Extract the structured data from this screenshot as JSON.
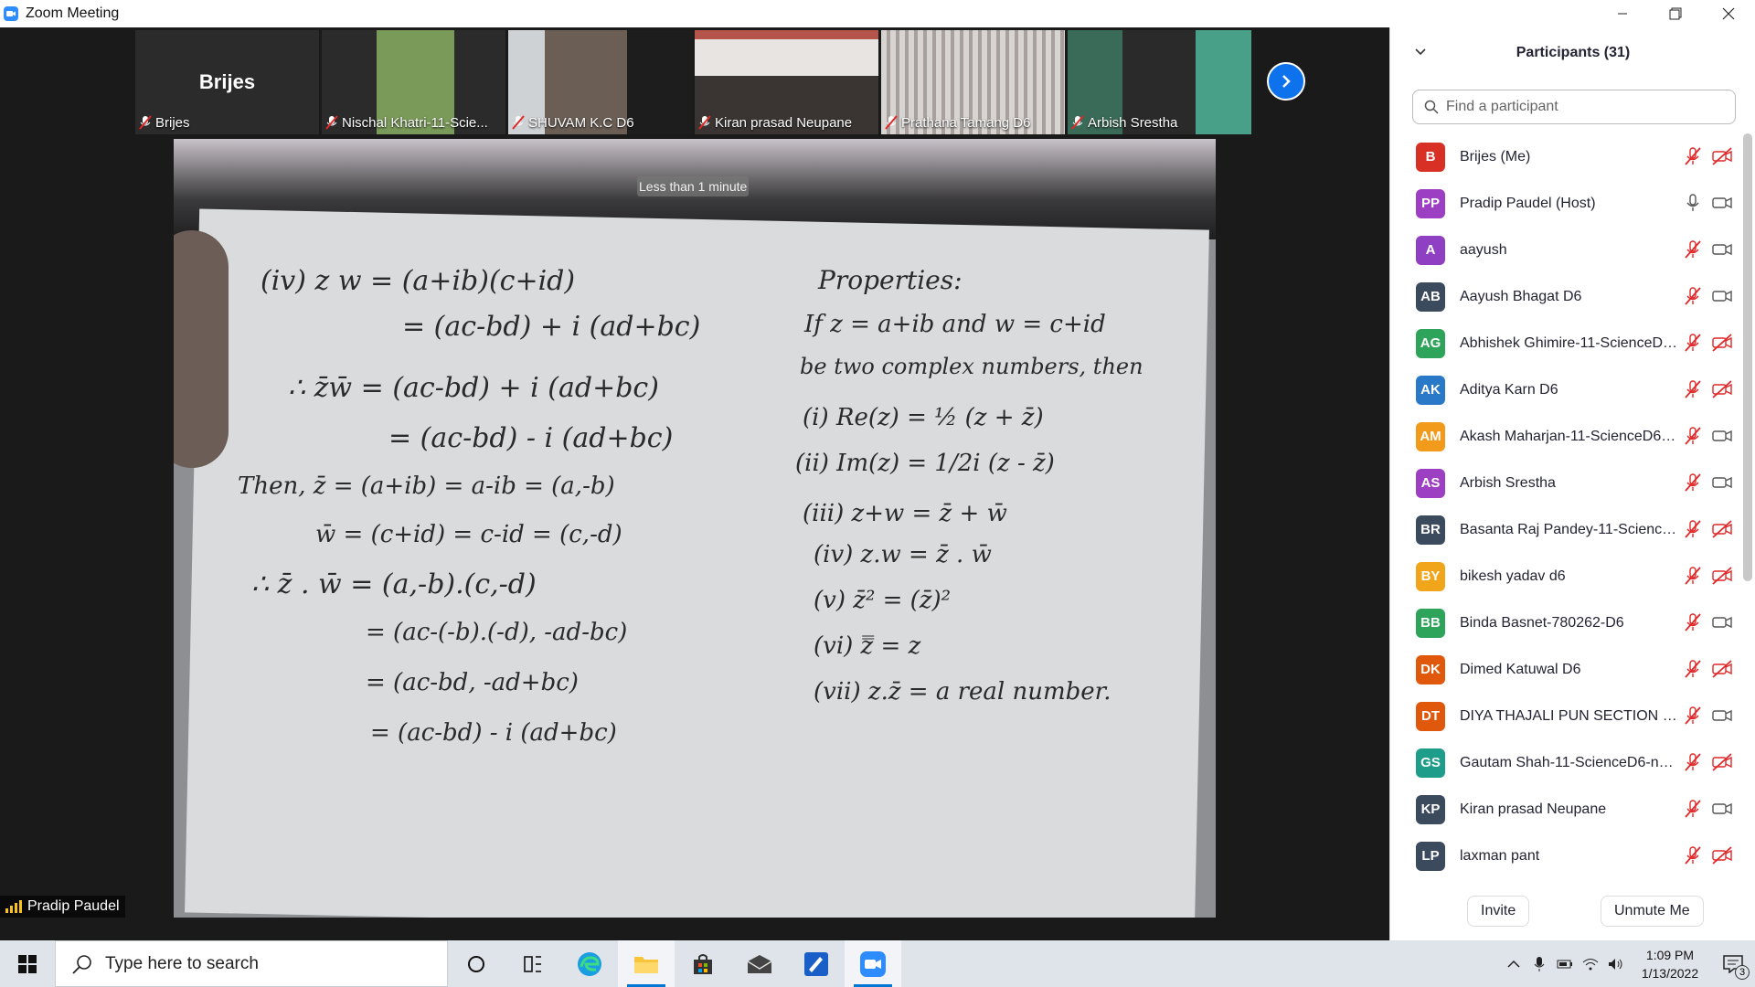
{
  "window": {
    "title": "Zoom Meeting",
    "controls": [
      "minimize",
      "restore",
      "close"
    ]
  },
  "thumbnails": [
    {
      "name": "Brijes",
      "big_name": "Brijes",
      "video": false,
      "muted": true
    },
    {
      "name": "Nischal Khatri-11-Scie...",
      "video": true,
      "muted": true,
      "bg": "#5a7a3a"
    },
    {
      "name": "SHUVAM K.C D6",
      "video": true,
      "muted": true,
      "bg": "#4a4440"
    },
    {
      "name": "Kiran prasad Neupane",
      "video": true,
      "muted": true,
      "bg": "#8d7d76"
    },
    {
      "name": "Prathana Tamang D6",
      "video": true,
      "muted": true,
      "bg": "#9a9290"
    },
    {
      "name": "Arbish Srestha",
      "video": true,
      "muted": true,
      "bg": "#3c5e4e"
    }
  ],
  "share": {
    "timer_text": "Less than 1 minute",
    "speaker_name": "Pradip Paudel",
    "board_left": [
      "(iv)  z w = (a+ib)(c+id)",
      "= (ac-bd) + i (ad+bc)",
      "∴ z̄w̄ = (ac-bd) + i (ad+bc)",
      "= (ac-bd) - i (ad+bc)",
      "Then, z̄ = (a+ib) = a-ib = (a,-b)",
      "w̄ = (c+id) = c-id = (c,-d)",
      "∴ z̄ . w̄ = (a,-b).(c,-d)",
      "= (ac-(-b).(-d), -ad-bc)",
      "= (ac-bd, -ad+bc)",
      "= (ac-bd) - i (ad+bc)"
    ],
    "board_right": [
      "Properties:",
      "If z = a+ib and w = c+id",
      "be two complex numbers, then",
      "(i)  Re(z) = ½ (z + z̄)",
      "(ii)  Im(z) = 1/2i (z - z̄)",
      "(iii)  z+w = z̄ + w̄",
      "(iv)  z.w = z̄ . w̄",
      "(v)  z̄² = (z̄)²",
      "(vi)  z̿ = z",
      "(vii)  z.z̄ = a real number."
    ]
  },
  "panel": {
    "title": "Participants (31)",
    "search_placeholder": "Find a participant",
    "participants": [
      {
        "initials": "B",
        "name": "Brijes (Me)",
        "color": "#d93025",
        "mic": "muted",
        "video": "off"
      },
      {
        "initials": "PP",
        "name": "Pradip Paudel (Host)",
        "color": "#9c3fc2",
        "mic": "on",
        "video": "on"
      },
      {
        "initials": "A",
        "name": "aayush",
        "color": "#8e3fc2",
        "mic": "muted",
        "video": "on"
      },
      {
        "initials": "AB",
        "name": "Aayush Bhagat D6",
        "color": "#3c4a5e",
        "mic": "muted",
        "video": "on"
      },
      {
        "initials": "AG",
        "name": "Abhishek Ghimire-11-ScienceD6...",
        "color": "#2ea35a",
        "mic": "muted",
        "video": "off"
      },
      {
        "initials": "AK",
        "name": "Aditya Karn D6",
        "color": "#2a79c9",
        "mic": "muted",
        "video": "off"
      },
      {
        "initials": "AM",
        "name": "Akash Maharjan-11-ScienceD6-n...",
        "color": "#f19a1b",
        "mic": "muted",
        "video": "on"
      },
      {
        "initials": "AS",
        "name": "Arbish Srestha",
        "color": "#9c3fc2",
        "mic": "muted",
        "video": "on"
      },
      {
        "initials": "BR",
        "name": "Basanta Raj Pandey-11-ScienceD...",
        "color": "#3c4a5e",
        "mic": "muted",
        "video": "off"
      },
      {
        "initials": "BY",
        "name": "bikesh yadav d6",
        "color": "#f1a51b",
        "mic": "muted",
        "video": "off"
      },
      {
        "initials": "BB",
        "name": "Binda Basnet-780262-D6",
        "color": "#2ea35a",
        "mic": "muted",
        "video": "on"
      },
      {
        "initials": "DK",
        "name": "Dimed Katuwal D6",
        "color": "#e0580b",
        "mic": "muted",
        "video": "off"
      },
      {
        "initials": "DT",
        "name": "DIYA THAJALI PUN SECTION D6",
        "color": "#e0580b",
        "mic": "muted",
        "video": "on"
      },
      {
        "initials": "GS",
        "name": "Gautam Shah-11-ScienceD6-null...",
        "color": "#1e9d8b",
        "mic": "muted",
        "video": "off"
      },
      {
        "initials": "KP",
        "name": "Kiran prasad Neupane",
        "color": "#3c4a5e",
        "mic": "muted",
        "video": "on"
      },
      {
        "initials": "LP",
        "name": "laxman pant",
        "color": "#3c4a5e",
        "mic": "muted",
        "video": "off"
      }
    ],
    "invite_label": "Invite",
    "unmute_label": "Unmute Me"
  },
  "taskbar": {
    "search_placeholder": "Type here to search",
    "apps": [
      "cortana-icon",
      "task-view-icon",
      "edge-icon",
      "file-explorer-icon",
      "store-icon",
      "mail-icon",
      "whiteboard-icon",
      "zoom-icon"
    ],
    "time": "1:09 PM",
    "date": "1/13/2022",
    "notification_count": "3"
  }
}
